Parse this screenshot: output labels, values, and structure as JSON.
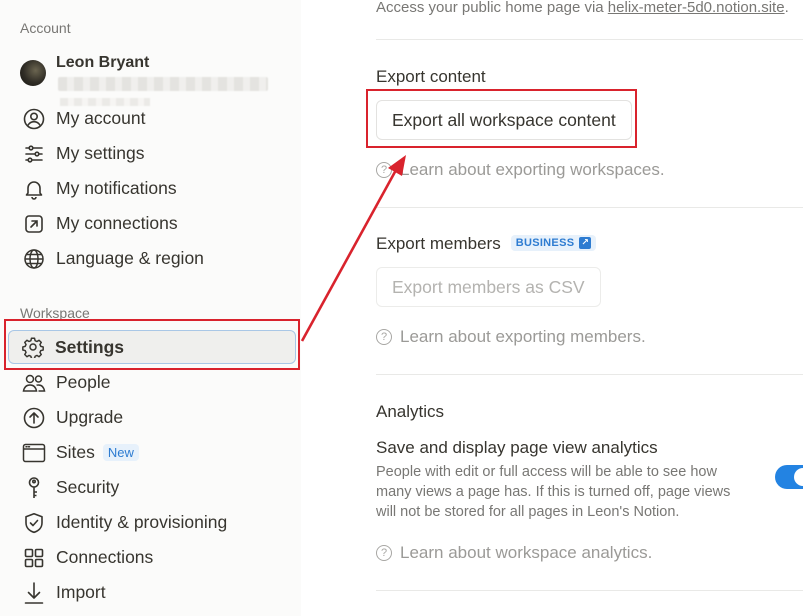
{
  "sidebar": {
    "account_label": "Account",
    "user": {
      "name": "Leon Bryant"
    },
    "account_items": [
      {
        "label": "My account",
        "icon": "user-circle-icon"
      },
      {
        "label": "My settings",
        "icon": "sliders-icon"
      },
      {
        "label": "My notifications",
        "icon": "bell-icon"
      },
      {
        "label": "My connections",
        "icon": "external-link-icon"
      },
      {
        "label": "Language & region",
        "icon": "globe-icon"
      }
    ],
    "workspace_label": "Workspace",
    "workspace_items": [
      {
        "label": "Settings",
        "icon": "gear-icon",
        "active": true
      },
      {
        "label": "People",
        "icon": "people-icon"
      },
      {
        "label": "Upgrade",
        "icon": "arrow-up-circle-icon"
      },
      {
        "label": "Sites",
        "icon": "browser-window-icon",
        "badge": "New"
      },
      {
        "label": "Security",
        "icon": "key-icon"
      },
      {
        "label": "Identity & provisioning",
        "icon": "shield-check-icon"
      },
      {
        "label": "Connections",
        "icon": "grid-icon"
      },
      {
        "label": "Import",
        "icon": "download-arrow-icon"
      }
    ]
  },
  "main": {
    "public_home": {
      "text": "Access your public home page via ",
      "link": "helix-meter-5d0.notion.site",
      "suffix": "."
    },
    "export_content": {
      "heading": "Export content",
      "button": "Export all workspace content",
      "help": "Learn about exporting workspaces."
    },
    "export_members": {
      "heading": "Export members",
      "badge": "BUSINESS",
      "button": "Export members as CSV",
      "help": "Learn about exporting members."
    },
    "analytics": {
      "heading": "Analytics",
      "setting_title": "Save and display page view analytics",
      "description": "People with edit or full access will be able to see how many views a page has. If this is turned off, page views will not be stored for all pages in Leon's Notion.",
      "toggle_on": true,
      "help": "Learn about workspace analytics."
    }
  },
  "colors": {
    "annotation_red": "#d9232d",
    "accent_blue": "#2383e2",
    "sidebar_bg": "#fbfbfa"
  }
}
